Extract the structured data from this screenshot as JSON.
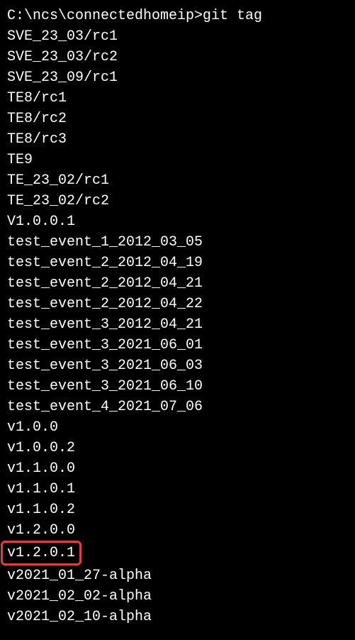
{
  "prompt": "C:\\ncs\\connectedhomeip>git tag",
  "tags": [
    "SVE_23_03/rc1",
    "SVE_23_03/rc2",
    "SVE_23_09/rc1",
    "TE8/rc1",
    "TE8/rc2",
    "TE8/rc3",
    "TE9",
    "TE_23_02/rc1",
    "TE_23_02/rc2",
    "V1.0.0.1",
    "test_event_1_2012_03_05",
    "test_event_2_2012_04_19",
    "test_event_2_2012_04_21",
    "test_event_2_2012_04_22",
    "test_event_3_2012_04_21",
    "test_event_3_2021_06_01",
    "test_event_3_2021_06_03",
    "test_event_3_2021_06_10",
    "test_event_4_2021_07_06",
    "v1.0.0",
    "v1.0.0.2",
    "v1.1.0.0",
    "v1.1.0.1",
    "v1.1.0.2",
    "v1.2.0.0",
    "v1.2.0.1",
    "v2021_01_27-alpha",
    "v2021_02_02-alpha",
    "v2021_02_10-alpha"
  ],
  "highlighted_index": 25
}
